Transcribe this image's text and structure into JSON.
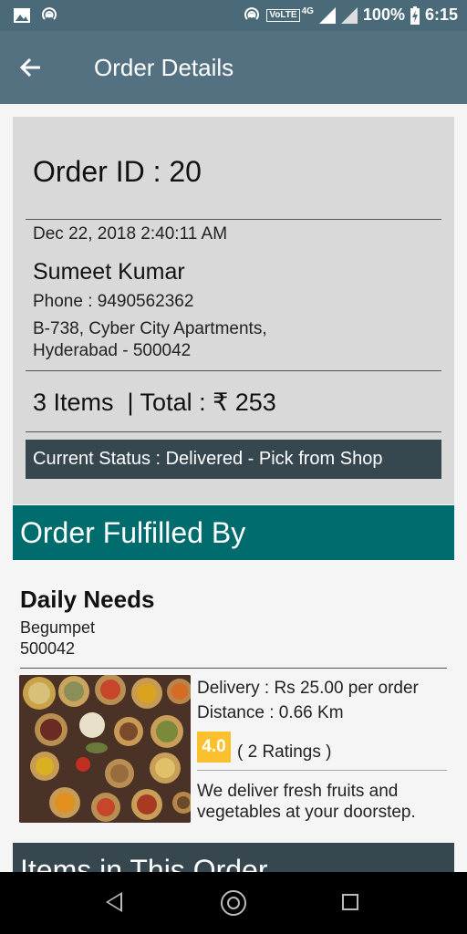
{
  "status_bar": {
    "battery": "100%",
    "time": "6:15",
    "volte": "VoLTE",
    "network": "4G",
    "icons": [
      "image-icon",
      "hotspot-icon",
      "wifi-hotspot-icon",
      "signal-icon",
      "battery-charging-icon"
    ]
  },
  "app_bar": {
    "title": "Order Details",
    "back_icon": "arrow-left-icon"
  },
  "order": {
    "id_text": "Order ID : 20",
    "date": "Dec 22, 2018 2:40:11 AM",
    "customer_name": "Sumeet Kumar",
    "phone": "Phone : 9490562362",
    "address_line1": "B-738, Cyber City Apartments,",
    "address_line2": "Hyderabad - 500042",
    "items_total": "3 Items  | Total : ₹ 253",
    "status": "Current Status : Delivered - Pick from Shop"
  },
  "fulfilled": {
    "header": "Order Fulfilled By",
    "shop_name": "Daily Needs",
    "area": "Begumpet",
    "pincode": "500042",
    "delivery": "Delivery : Rs 25.00 per order",
    "distance": "Distance : 0.66 Km",
    "rating": "4.0",
    "ratings_count": "( 2 Ratings )",
    "description": "We deliver fresh fruits and vegetables at your doorstep."
  },
  "items_section": {
    "header": "Items in This Order"
  },
  "colors": {
    "app_bar": "#537181",
    "status_bar": "#4a6a7a",
    "teal_header": "#006c6e",
    "dark_header": "#37474f",
    "rating": "#fbc02d"
  }
}
